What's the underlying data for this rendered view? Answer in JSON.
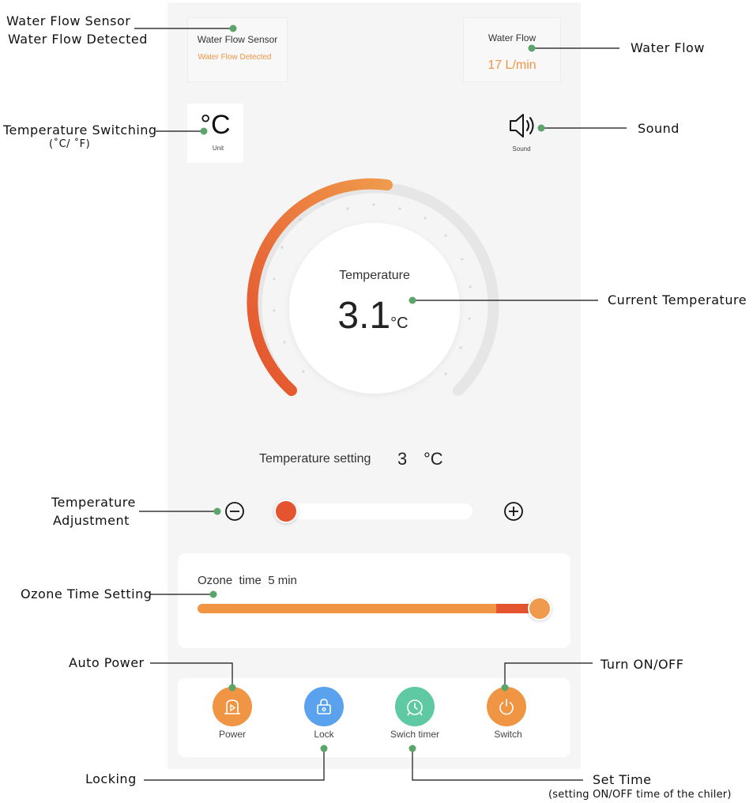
{
  "water_flow_sensor": {
    "title": "Water Flow Sensor",
    "status": "Water Flow Detected"
  },
  "water_flow": {
    "title": "Water Flow",
    "value": "17 L/min"
  },
  "unit": {
    "symbol": "°C",
    "label": "Unit"
  },
  "sound": {
    "label": "Sound"
  },
  "temperature": {
    "label": "Temperature",
    "value": "3.1",
    "unit": "°C"
  },
  "temperature_setting": {
    "label": "Temperature setting",
    "value": "3",
    "unit": "°C"
  },
  "ozone": {
    "label": "Ozone  time  5 min",
    "level": 1.0
  },
  "buttons": [
    {
      "label": "Power",
      "color": "#ef9544"
    },
    {
      "label": "Lock",
      "color": "#5aa1ee"
    },
    {
      "label": "Swich timer",
      "color": "#5ec9a3"
    },
    {
      "label": "Switch",
      "color": "#ef9544"
    }
  ],
  "annotations": {
    "water_flow_sensor_1": "Water Flow Sensor",
    "water_flow_sensor_2": "Water Flow Detected",
    "water_flow": "Water Flow",
    "temp_switching_1": "Temperature Switching",
    "temp_switching_2": "(˚C/ ˚F)",
    "sound": "Sound",
    "current_temperature": "Current Temperature",
    "temp_adjustment_1": "Temperature",
    "temp_adjustment_2": "Adjustment",
    "ozone_time_setting": "Ozone Time Setting",
    "auto_power": "Auto Power",
    "turn_on_off": "Turn ON/OFF",
    "locking": "Locking",
    "set_time": "Set Time",
    "set_time_note": "(setting ON/OFF time of the chiler)"
  },
  "colors": {
    "accent_orange": "#ef9544",
    "accent_red": "#e4552f",
    "annotation_dot": "#5ba56a"
  }
}
